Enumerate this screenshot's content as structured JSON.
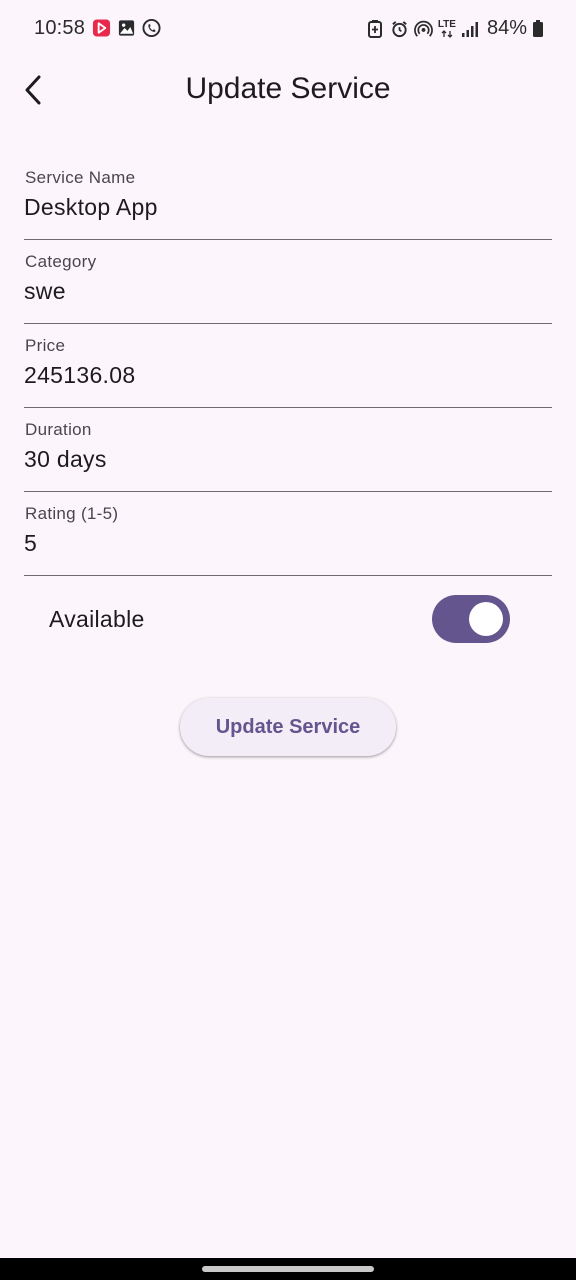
{
  "status_bar": {
    "time": "10:58",
    "battery_text": "84%",
    "network_label": "LTE",
    "left_icons": [
      "video-app-icon",
      "gallery-icon",
      "phone-call-icon"
    ],
    "right_icons": [
      "battery-saver-icon",
      "alarm-icon",
      "hotspot-icon",
      "lte-icon",
      "signal-icon",
      "battery-icon"
    ]
  },
  "app_bar": {
    "title": "Update Service",
    "back_icon": "arrow-back-icon"
  },
  "form": {
    "fields": [
      {
        "label": "Service Name",
        "value": "Desktop App"
      },
      {
        "label": "Category",
        "value": "swe"
      },
      {
        "label": "Price",
        "value": "245136.08"
      },
      {
        "label": "Duration",
        "value": "30 days"
      },
      {
        "label": "Rating (1-5)",
        "value": "5"
      }
    ],
    "available": {
      "label": "Available",
      "checked": true
    },
    "submit_label": "Update Service"
  },
  "colors": {
    "background": "#FCF6FC",
    "primary": "#65558F",
    "button_surface": "#F3EDF7",
    "divider": "#6E6A72",
    "text": "#1D1B20"
  }
}
